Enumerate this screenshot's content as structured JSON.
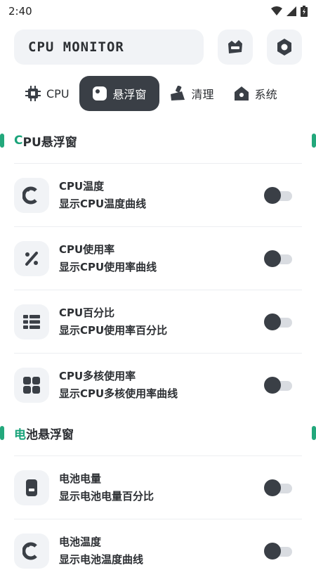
{
  "status": {
    "time": "2:40"
  },
  "header": {
    "title": "CPU MONITOR"
  },
  "tabs": [
    {
      "label": "CPU"
    },
    {
      "label": "悬浮窗"
    },
    {
      "label": "清理"
    },
    {
      "label": "系统"
    }
  ],
  "sections": [
    {
      "title_accent": "C",
      "title_rest": "PU悬浮窗",
      "items": [
        {
          "title": "CPU温度",
          "desc": "显示CPU温度曲线",
          "enabled": false
        },
        {
          "title": "CPU使用率",
          "desc": "显示CPU使用率曲线",
          "enabled": false
        },
        {
          "title": "CPU百分比",
          "desc": "显示CPU使用率百分比",
          "enabled": false
        },
        {
          "title": "CPU多核使用率",
          "desc": "显示CPU多核使用率曲线",
          "enabled": false
        }
      ]
    },
    {
      "title_accent": "电",
      "title_rest": "池悬浮窗",
      "items": [
        {
          "title": "电池电量",
          "desc": "显示电池电量百分比",
          "enabled": false
        },
        {
          "title": "电池温度",
          "desc": "显示电池温度曲线",
          "enabled": false
        }
      ]
    }
  ]
}
